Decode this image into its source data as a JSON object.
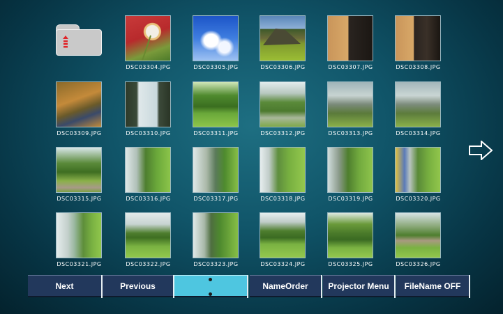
{
  "grid": {
    "row1": [
      "DSC03304.JPG",
      "DSC03305.JPG",
      "DSC03306.JPG",
      "DSC03307.JPG",
      "DSC03308.JPG"
    ],
    "row2": [
      "DSC03309.JPG",
      "DSC03310.JPG",
      "DSC03311.JPG",
      "DSC03312.JPG",
      "DSC03313.JPG",
      "DSC03314.JPG"
    ],
    "row3": [
      "DSC03315.JPG",
      "DSC03316.JPG",
      "DSC03317.JPG",
      "DSC03318.JPG",
      "DSC03319.JPG",
      "DSC03320.JPG"
    ],
    "row4": [
      "DSC03321.JPG",
      "DSC03322.JPG",
      "DSC03323.JPG",
      "DSC03324.JPG",
      "DSC03325.JPG",
      "DSC03326.JPG"
    ]
  },
  "icons": {
    "folder": "folder-up-icon",
    "next_page": "arrow-right-icon"
  },
  "toolbar": {
    "next": "Next",
    "previous": "Previous",
    "name_order": "NameOrder",
    "projector_menu": "Projector Menu",
    "filename": "FileName OFF"
  },
  "colors": {
    "button": "#22385c",
    "button_active": "#4ec6e0",
    "folder_arrow": "#e0262b"
  }
}
